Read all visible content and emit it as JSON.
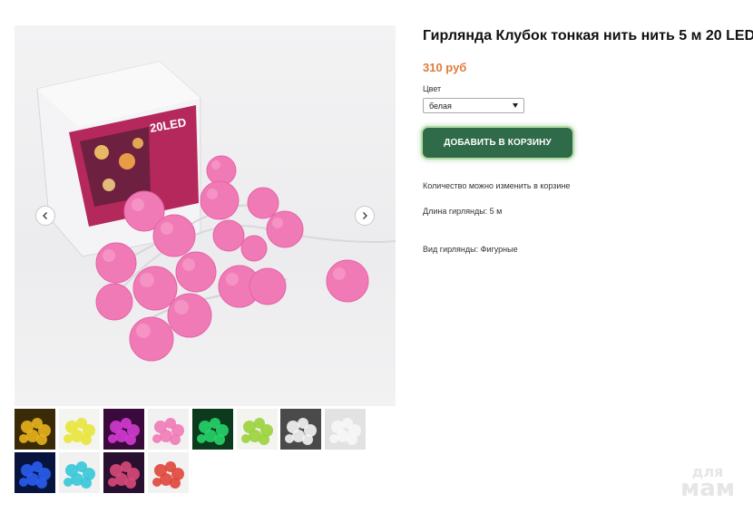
{
  "product": {
    "title": "Гирлянда Клубок тонкая нить нить 5 м 20 LED",
    "price": "310 руб",
    "color_label": "Цвет",
    "color_selected": "белая",
    "add_to_cart_label": "ДОБАВИТЬ В КОРЗИНУ",
    "quantity_note": "Количество можно изменить в корзине",
    "length_info": "Длина гирлянды: 5 м",
    "type_info": "Вид гирлянды: Фигурные"
  },
  "gallery": {
    "package_text": "20LED",
    "icons": {
      "prev": "chevron-left-icon",
      "next": "chevron-right-icon"
    },
    "ball_color": "#f07ab6",
    "thumbnails": [
      {
        "color": "#e8b21c",
        "bg": "#3a2a08"
      },
      {
        "color": "#e9e63a",
        "bg": "#f4f4f0"
      },
      {
        "color": "#d23bd0",
        "bg": "#3a0a3c"
      },
      {
        "color": "#f07ab6",
        "bg": "#f1f1f2"
      },
      {
        "color": "#27d46b",
        "bg": "#0c3a1c"
      },
      {
        "color": "#9ad33a",
        "bg": "#f3f3f0"
      },
      {
        "color": "#f4f4f4",
        "bg": "#4a4a4a"
      },
      {
        "color": "#f7f7f7",
        "bg": "#e2e2e2"
      },
      {
        "color": "#2a5cf0",
        "bg": "#06143e"
      },
      {
        "color": "#36c6d8",
        "bg": "#f1f1f2"
      },
      {
        "color": "#d84a7a",
        "bg": "#2a1030"
      },
      {
        "color": "#e0463a",
        "bg": "#f2f2f2"
      }
    ]
  },
  "watermark": {
    "line1": "для",
    "line2": "мам"
  }
}
